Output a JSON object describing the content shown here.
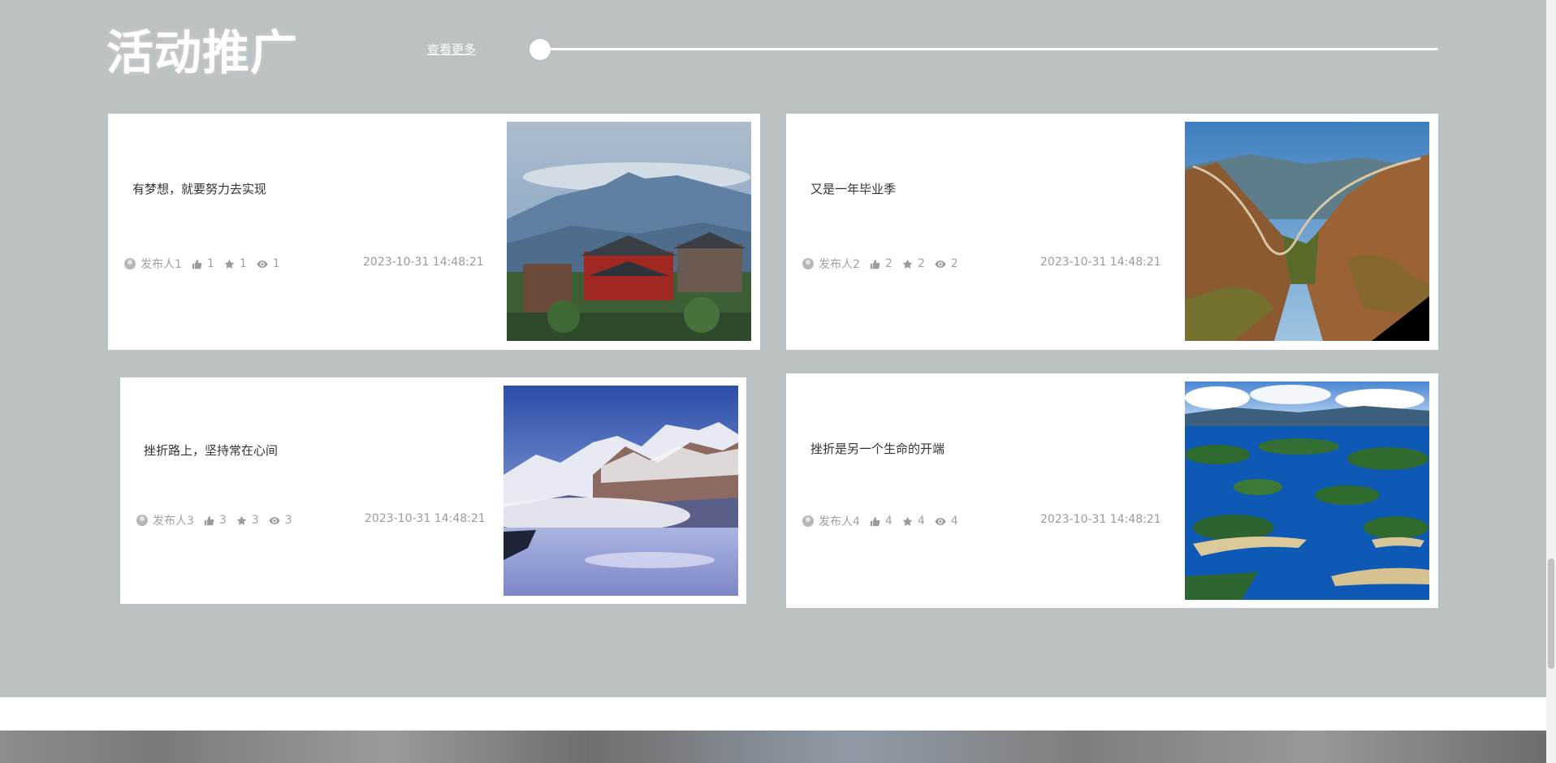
{
  "section": {
    "title": "活动推广",
    "more_label": "查看更多"
  },
  "cards": [
    {
      "title": "有梦想，就要努力去实现",
      "publisher": "发布人1",
      "likes": "1",
      "favorites": "1",
      "views": "1",
      "date": "2023-10-31 14:48:21",
      "image": "temple-mountain-image"
    },
    {
      "title": "又是一年毕业季",
      "publisher": "发布人2",
      "likes": "2",
      "favorites": "2",
      "views": "2",
      "date": "2023-10-31 14:48:21",
      "image": "great-wall-image"
    },
    {
      "title": "挫折路上，坚持常在心间",
      "publisher": "发布人3",
      "likes": "3",
      "favorites": "3",
      "views": "3",
      "date": "2023-10-31 14:48:21",
      "image": "snow-mountain-image"
    },
    {
      "title": "挫折是另一个生命的开端",
      "publisher": "发布人4",
      "likes": "4",
      "favorites": "4",
      "views": "4",
      "date": "2023-10-31 14:48:21",
      "image": "lake-islands-image"
    }
  ],
  "colors": {
    "section_background": "#bcc1c4",
    "card_background": "#ffffff",
    "meta_text": "#a0a0a0"
  },
  "icons": [
    "avatar",
    "thumbs-up-icon",
    "star-icon",
    "eye-icon"
  ]
}
